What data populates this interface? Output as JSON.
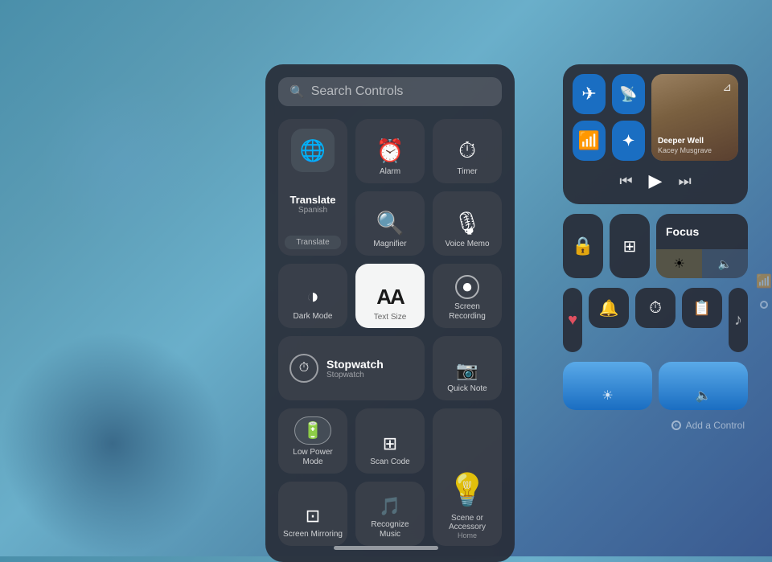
{
  "background": {
    "gradient": "linear-gradient(135deg, #4a8faa, #6aafca, #4570a0)"
  },
  "searchPanel": {
    "searchBar": {
      "placeholder": "Search Controls",
      "icon": "🔍"
    },
    "controls": [
      {
        "id": "translate",
        "type": "large",
        "name": "Translate",
        "sublabel": "Spanish",
        "btnLabel": "Translate",
        "icon": "🌐"
      },
      {
        "id": "alarm",
        "type": "normal",
        "name": "Alarm",
        "icon": "⏰"
      },
      {
        "id": "timer",
        "type": "normal",
        "name": "Timer",
        "icon": "⏱"
      },
      {
        "id": "magnifier",
        "type": "normal",
        "name": "Magnifier",
        "icon": "🔍"
      },
      {
        "id": "voice-memo",
        "type": "normal",
        "name": "Voice Memo",
        "icon": "🎙"
      },
      {
        "id": "dark-mode",
        "type": "normal",
        "name": "Dark Mode",
        "icon": "◑"
      },
      {
        "id": "text-size",
        "type": "textsize",
        "name": "Text Size",
        "icon": "AA"
      },
      {
        "id": "screen-recording",
        "type": "normal",
        "name": "Screen Recording",
        "icon": "⏺"
      },
      {
        "id": "stopwatch",
        "type": "wide",
        "name": "Stopwatch",
        "sublabel": "Stopwatch",
        "icon": "⏱"
      },
      {
        "id": "quick-note",
        "type": "normal",
        "name": "Quick Note",
        "icon": "📷"
      },
      {
        "id": "low-power-mode",
        "type": "normal",
        "name": "Low Power Mode",
        "icon": "🔋"
      },
      {
        "id": "scan-code",
        "type": "normal",
        "name": "Scan Code",
        "icon": "⊞"
      },
      {
        "id": "home",
        "type": "tall",
        "name": "Scene or Accessory",
        "sublabel": "Home",
        "icon": "💡"
      },
      {
        "id": "screen-mirroring",
        "type": "normal",
        "name": "Screen Mirroring",
        "icon": "⊡"
      },
      {
        "id": "recognize-music",
        "type": "normal",
        "name": "Recognize Music",
        "icon": "🎵"
      }
    ]
  },
  "rightPanel": {
    "media": {
      "airplane": "✈",
      "cellular": "📡",
      "wifi": "📶",
      "bluetooth": "✦",
      "track": "Deeper Well",
      "artist": "Kacey Musgrave",
      "prevIcon": "⏮",
      "playIcon": "▶",
      "nextIcon": "⏭",
      "airplayIcon": "⊿"
    },
    "focus": {
      "label": "Focus",
      "sunIcon": "☀",
      "volIcon": "🔈"
    },
    "addControl": "Add a Control"
  }
}
